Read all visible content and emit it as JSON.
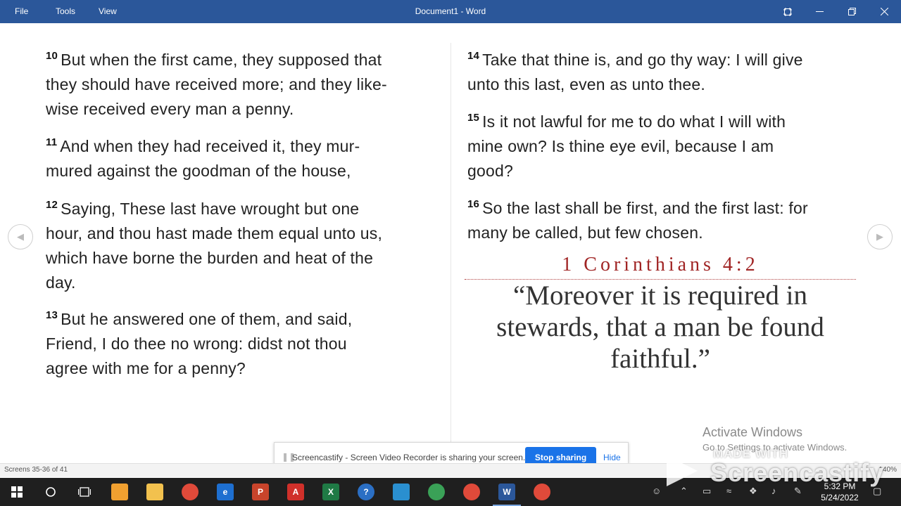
{
  "titlebar": {
    "menu": [
      "File",
      "Tools",
      "View"
    ],
    "title": "Document1 - Word"
  },
  "verses_left": [
    {
      "num": "10",
      "lines": [
        "But when the first came, they supposed that",
        "they should have received more; and they like-",
        "wise received every man a penny."
      ]
    },
    {
      "num": "11",
      "lines": [
        "And when they had received it, they mur-",
        "mured against the goodman of the house,"
      ]
    },
    {
      "num": "12",
      "lines": [
        "Saying, These last have wrought but one",
        "hour, and thou hast made them equal unto us,",
        "which have borne the burden and heat of the",
        "day."
      ]
    },
    {
      "num": "13",
      "lines": [
        "But he answered one of them, and said,",
        "Friend, I do thee no wrong: didst not thou",
        "agree with me for a penny?"
      ]
    }
  ],
  "verses_right": [
    {
      "num": "14",
      "lines": [
        "Take that thine is, and go thy way: I will give",
        "unto this last, even as unto thee."
      ]
    },
    {
      "num": "15",
      "lines": [
        "Is it not lawful for me to do what I will with",
        "mine own? Is thine eye evil, because I am",
        "good?"
      ]
    },
    {
      "num": "16",
      "lines": [
        "So the last shall be first, and the first last: for",
        "many be called, but few chosen."
      ]
    }
  ],
  "callout": {
    "reference": "1 Corinthians 4:2",
    "quote_lines": [
      "“Moreover it is required in",
      "stewards, that a man be found",
      "faithful.”"
    ]
  },
  "activate": {
    "line1": "Activate Windows",
    "line2": "Go to Settings to activate Windows."
  },
  "share_bar": {
    "message": "Screencastify - Screen Video Recorder is sharing your screen.",
    "stop_label": "Stop sharing",
    "hide_label": "Hide"
  },
  "statusbar": {
    "text": "Screens 35-36 of 41",
    "zoom": "140%"
  },
  "watermark": {
    "line1": "MADE WITH",
    "line2": "Screencastify"
  },
  "taskbar": {
    "time": "5:32 PM",
    "date": "5/24/2022",
    "apps": [
      {
        "name": "file-explorer",
        "label": "",
        "color": "#f2c14e"
      },
      {
        "name": "chrome",
        "label": "",
        "color": "#e04a3a"
      },
      {
        "name": "edge",
        "label": "e",
        "color": "#1e6fd0"
      },
      {
        "name": "powerpoint",
        "label": "P",
        "color": "#c9442b"
      },
      {
        "name": "acrobat",
        "label": "A",
        "color": "#d0302a"
      },
      {
        "name": "excel",
        "label": "X",
        "color": "#1f7a45"
      },
      {
        "name": "help",
        "label": "?",
        "color": "#2b6fc4"
      },
      {
        "name": "notes",
        "label": "",
        "color": "#2a8fd0"
      },
      {
        "name": "chrome-2",
        "label": "",
        "color": "#3aa157"
      },
      {
        "name": "chrome-3",
        "label": "",
        "color": "#e04a3a"
      },
      {
        "name": "word",
        "label": "W",
        "color": "#2b579a"
      },
      {
        "name": "chrome-4",
        "label": "",
        "color": "#e04a3a"
      }
    ]
  },
  "colors": {
    "titlebar": "#2b579a",
    "reference": "#a02424",
    "stop_button": "#1a73e8",
    "taskbar": "#1f1f1f"
  }
}
